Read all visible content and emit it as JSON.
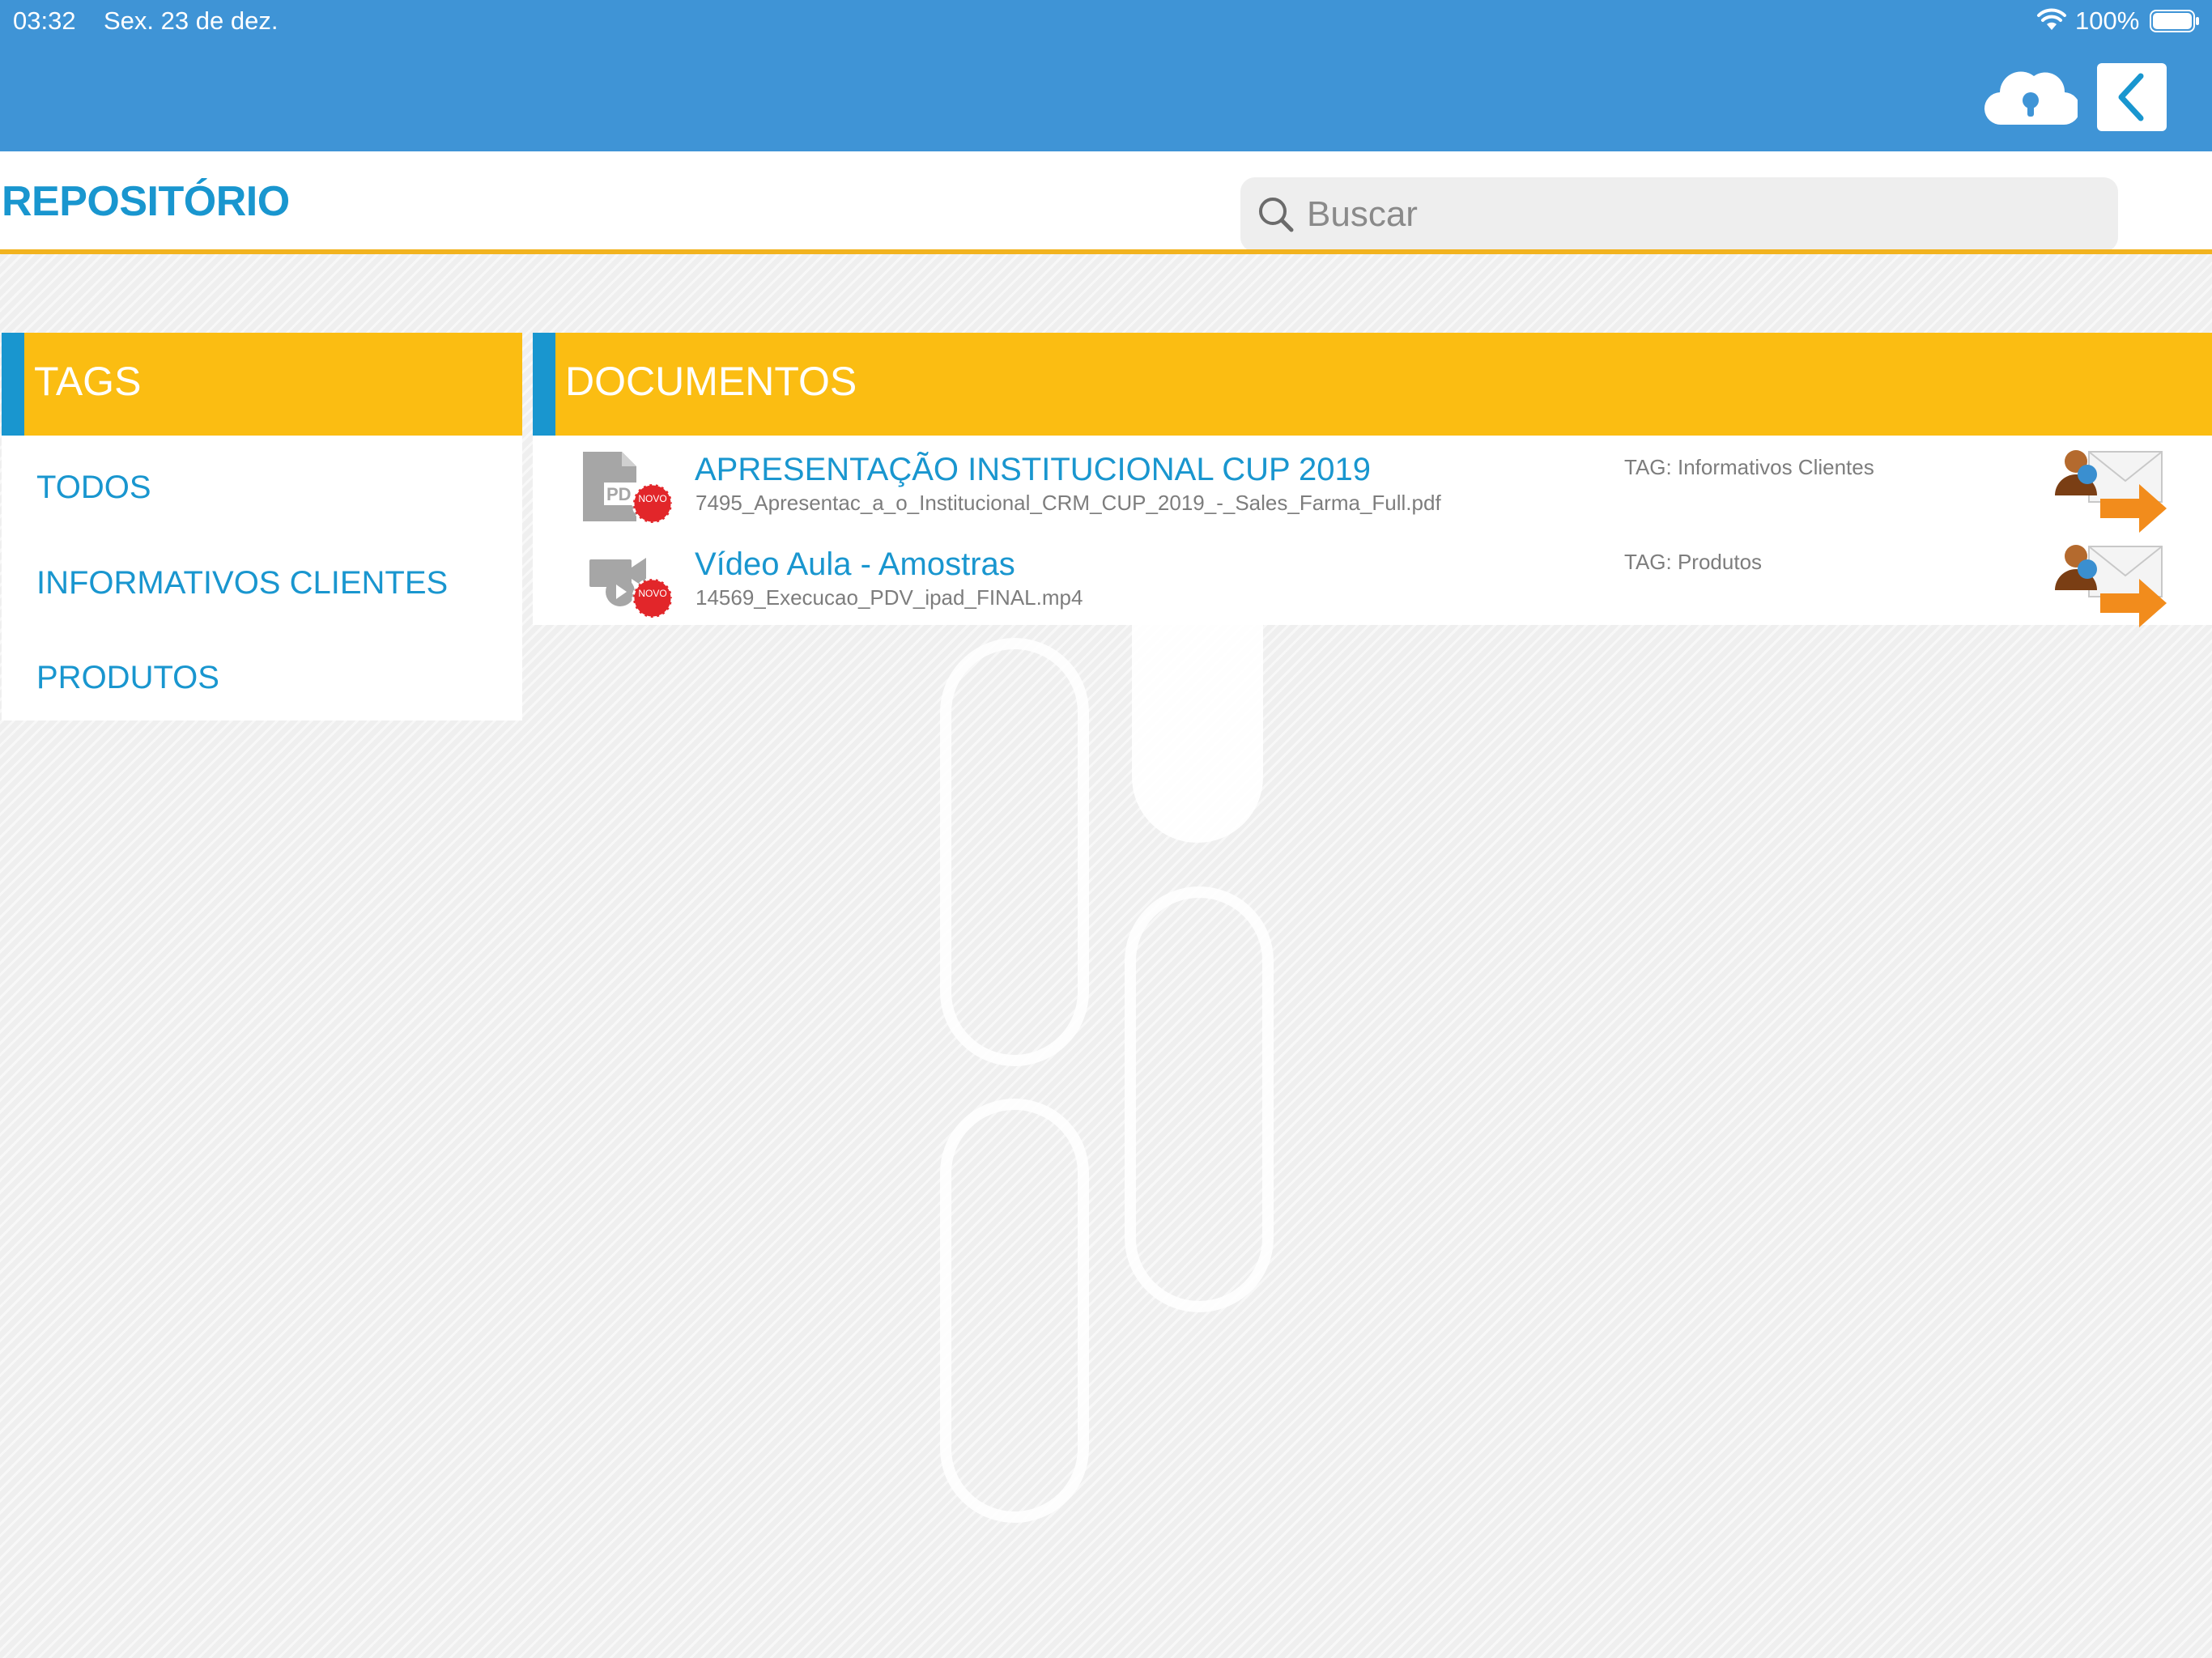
{
  "status_bar": {
    "time": "03:32",
    "date": "Sex. 23 de dez.",
    "battery": "100%"
  },
  "header": {
    "title": "REPOSITÓRIO",
    "search": {
      "placeholder": "Buscar",
      "value": ""
    }
  },
  "tags_panel": {
    "title": "TAGS",
    "items": [
      {
        "label": "TODOS"
      },
      {
        "label": "INFORMATIVOS CLIENTES"
      },
      {
        "label": "PRODUTOS"
      }
    ]
  },
  "documents_panel": {
    "title": "DOCUMENTOS",
    "items": [
      {
        "title": "APRESENTAÇÃO INSTITUCIONAL CUP 2019",
        "filename": "7495_Apresentac_a_o_Institucional_CRM_CUP_2019_-_Sales_Farma_Full.pdf",
        "tag": "TAG: Informativos Clientes",
        "icon": "pdf-file-icon",
        "badge": "NOVO"
      },
      {
        "title": "Vídeo Aula - Amostras",
        "filename": "14569_Execucao_PDV_ipad_FINAL.mp4",
        "tag": "TAG: Produtos",
        "icon": "video-file-icon",
        "badge": "NOVO"
      }
    ]
  },
  "colors": {
    "topbar": "#3f94d6",
    "accent_blue": "#1996cf",
    "accent_yellow": "#fbbd12",
    "underline": "#f2b31f"
  }
}
